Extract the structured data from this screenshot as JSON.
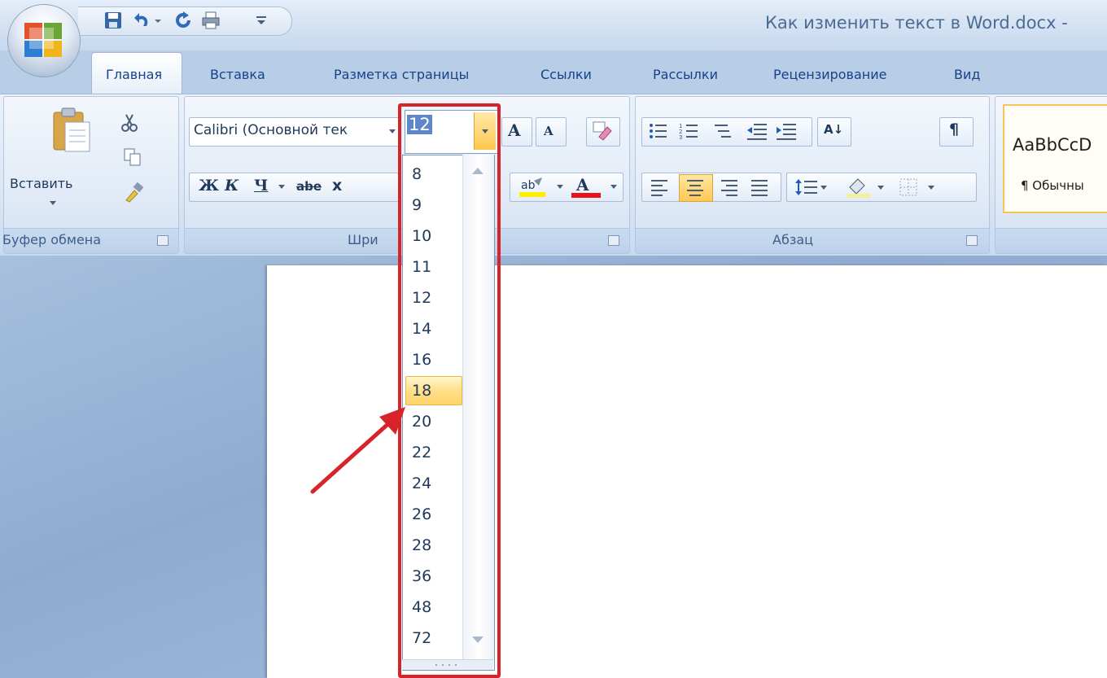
{
  "window": {
    "title": "Как изменить текст в Word.docx -"
  },
  "tabs": [
    {
      "label": "Главная",
      "active": true
    },
    {
      "label": "Вставка"
    },
    {
      "label": "Разметка страницы"
    },
    {
      "label": "Ссылки"
    },
    {
      "label": "Рассылки"
    },
    {
      "label": "Рецензирование"
    },
    {
      "label": "Вид"
    }
  ],
  "clipboard": {
    "paste_label": "Вставить",
    "group_label": "Буфер обмена"
  },
  "font": {
    "name_value": "Calibri (Основной тек",
    "size_value": "12",
    "group_label": "Шри",
    "bold": "Ж",
    "italic": "К",
    "underline": "Ч",
    "strike": "abe",
    "sub": "x",
    "grow": "A",
    "shrink": "A"
  },
  "paragraph": {
    "group_label": "Абзац",
    "pilcrow": "¶",
    "sort": "А↓"
  },
  "styles": {
    "sample": "AaBbCcD",
    "normal": "¶ Обычны"
  },
  "font_size_dropdown": {
    "items": [
      "8",
      "9",
      "10",
      "11",
      "12",
      "14",
      "16",
      "18",
      "20",
      "22",
      "24",
      "26",
      "28",
      "36",
      "48",
      "72"
    ],
    "hovered": "18"
  },
  "colors": {
    "accent_red": "#d8232a",
    "highlight": "#ffd36b",
    "ribbon_text": "#15428b"
  }
}
